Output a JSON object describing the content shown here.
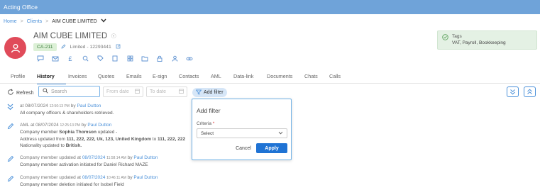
{
  "app": {
    "title": "Acting Office"
  },
  "breadcrumb": {
    "home": "Home",
    "clients": "Clients",
    "current": "AIM CUBE LIMITED"
  },
  "client": {
    "name": "AIM CUBE LIMITED",
    "code": "CA-211",
    "company_info": "Limited - 12293441"
  },
  "tags": {
    "label": "Tags",
    "value": "VAT, Payroll, Bookkeeping"
  },
  "tabs": [
    "Profile",
    "History",
    "Invoices",
    "Quotes",
    "Emails",
    "E-sign",
    "Contacts",
    "AML",
    "Data-link",
    "Documents",
    "Chats",
    "Calls"
  ],
  "active_tab": "History",
  "toolbar": {
    "refresh": "Refresh",
    "search_placeholder": "Search",
    "from_date": "From date",
    "to_date": "To date",
    "add_filter": "Add filter"
  },
  "history": [
    {
      "prefix": "at",
      "date": "08/07/2024",
      "time": "12:50:13 PM",
      "by": "by",
      "user": "Paul Dutton",
      "lines": [
        "All company officers & shareholders retrieved."
      ]
    },
    {
      "prefix": "AML at",
      "date": "08/07/2024",
      "time": "12:25:13 PM",
      "by": "by",
      "user": "Paul Dutton",
      "member_prefix": "Company member",
      "member_name": "Sophia Thomson",
      "member_suffix": "updated -",
      "address_prefix": "Address updated from",
      "address_from": "111, 222, 222, Uk, 123, United Kingdom",
      "address_to_word": "to",
      "address_to": "111, 222, 222",
      "nationality_prefix": "Nationality updated to",
      "nationality": "British."
    },
    {
      "prefix": "Company member updated at",
      "date": "08/07/2024",
      "time": "11:58:14 AM",
      "by": "by",
      "user": "Paul Dutton",
      "lines": [
        "Company member activation initiated for Daniel Richard MAZE"
      ]
    },
    {
      "prefix": "Company member updated at",
      "date": "08/07/2024",
      "time": "10:46:11 AM",
      "by": "by",
      "user": "Paul Dutton",
      "lines": [
        "Company member deletion initiated for Isobel Field"
      ]
    }
  ],
  "filter_panel": {
    "title": "Add filter",
    "criteria_label": "Criteria",
    "required_mark": "*",
    "criteria_value": "Select",
    "cancel": "Cancel",
    "apply": "Apply"
  },
  "colors": {
    "header": "#6fa3d9",
    "accent": "#4a90d9",
    "avatar": "#e04b5a",
    "apply": "#1f73d4",
    "code_badge": "#dcf0d6",
    "tags_bg": "#e4f1e4"
  }
}
